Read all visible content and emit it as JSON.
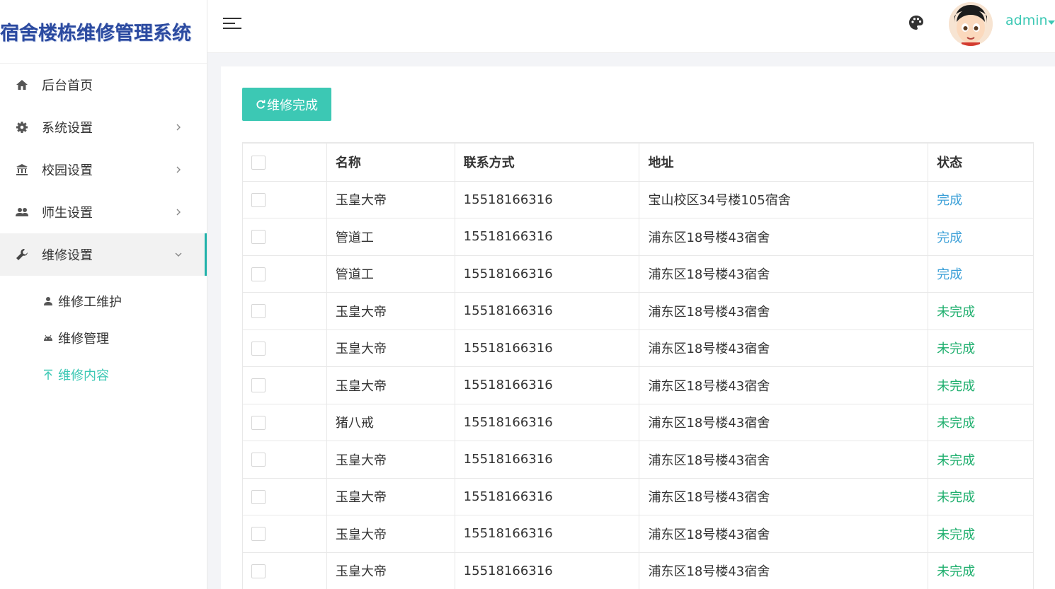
{
  "app": {
    "title": "宿舍楼栋维修管理系统"
  },
  "header": {
    "username": "admin"
  },
  "sidebar": {
    "items": [
      {
        "label": "后台首页",
        "icon": "home-icon"
      },
      {
        "label": "系统设置",
        "icon": "gear-icon"
      },
      {
        "label": "校园设置",
        "icon": "bank-icon"
      },
      {
        "label": "师生设置",
        "icon": "people-icon"
      },
      {
        "label": "维修设置",
        "icon": "wrench-icon"
      }
    ],
    "subitems": [
      {
        "label": "维修工维护",
        "icon": "person-icon"
      },
      {
        "label": "维修管理",
        "icon": "android-icon"
      },
      {
        "label": "维修内容",
        "icon": "arrow-up-icon"
      }
    ]
  },
  "toolbar": {
    "complete_label": "维修完成"
  },
  "table": {
    "headers": [
      "名称",
      "联系方式",
      "地址",
      "状态"
    ],
    "rows": [
      {
        "name": "玉皇大帝",
        "phone": "15518166316",
        "address": "宝山校区34号楼105宿舍",
        "status": "完成"
      },
      {
        "name": "管道工",
        "phone": "15518166316",
        "address": "浦东区18号楼43宿舍",
        "status": "完成"
      },
      {
        "name": "管道工",
        "phone": "15518166316",
        "address": "浦东区18号楼43宿舍",
        "status": "完成"
      },
      {
        "name": "玉皇大帝",
        "phone": "15518166316",
        "address": "浦东区18号楼43宿舍",
        "status": "未完成"
      },
      {
        "name": "玉皇大帝",
        "phone": "15518166316",
        "address": "浦东区18号楼43宿舍",
        "status": "未完成"
      },
      {
        "name": "玉皇大帝",
        "phone": "15518166316",
        "address": "浦东区18号楼43宿舍",
        "status": "未完成"
      },
      {
        "name": "猪八戒",
        "phone": "15518166316",
        "address": "浦东区18号楼43宿舍",
        "status": "未完成"
      },
      {
        "name": "玉皇大帝",
        "phone": "15518166316",
        "address": "浦东区18号楼43宿舍",
        "status": "未完成"
      },
      {
        "name": "玉皇大帝",
        "phone": "15518166316",
        "address": "浦东区18号楼43宿舍",
        "status": "未完成"
      },
      {
        "name": "玉皇大帝",
        "phone": "15518166316",
        "address": "浦东区18号楼43宿舍",
        "status": "未完成"
      },
      {
        "name": "玉皇大帝",
        "phone": "15518166316",
        "address": "浦东区18号楼43宿舍",
        "status": "未完成"
      }
    ]
  },
  "colors": {
    "accent": "#3cc8b4",
    "done": "#3ca0d8",
    "undone": "#1faf6e",
    "logo": "#2b4aa0"
  }
}
